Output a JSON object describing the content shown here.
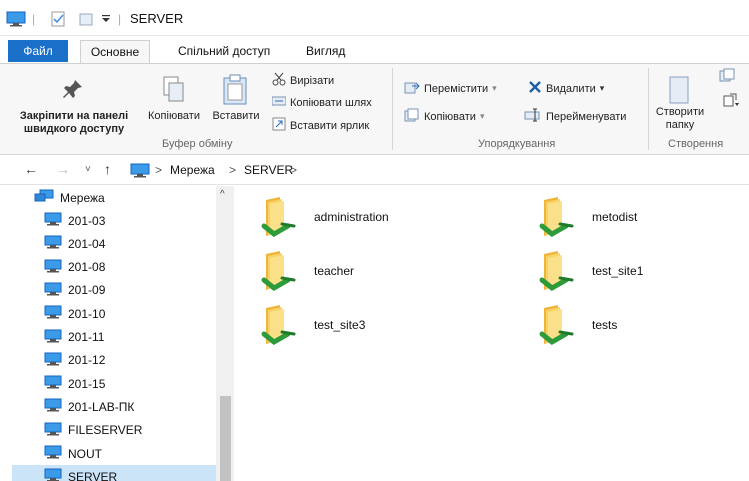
{
  "window": {
    "title": "SERVER"
  },
  "tabs": {
    "file": "Файл",
    "home": "Основне",
    "share": "Спільний доступ",
    "view": "Вигляд"
  },
  "ribbon": {
    "pin": "Закріпити на панелі швидкого доступу",
    "copy": "Копіювати",
    "paste": "Вставити",
    "cut": "Вирізати",
    "copy_path": "Копіювати шлях",
    "paste_shortcut": "Вставити ярлик",
    "clipboard_group": "Буфер обміну",
    "move_to": "Перемістити",
    "copy_to": "Копіювати",
    "delete": "Видалити",
    "rename": "Перейменувати",
    "organize_group": "Упорядкування",
    "new_folder": "Створити папку",
    "new_group": "Створення"
  },
  "nav": {
    "crumb1": "Мережа",
    "crumb2": "SERVER",
    "sep": ">"
  },
  "sidebar": {
    "root": "Мережа",
    "items": [
      {
        "label": "201-03"
      },
      {
        "label": "201-04"
      },
      {
        "label": "201-08"
      },
      {
        "label": "201-09"
      },
      {
        "label": "201-10"
      },
      {
        "label": "201-11"
      },
      {
        "label": "201-12"
      },
      {
        "label": "201-15"
      },
      {
        "label": "201-LAB-ПК"
      },
      {
        "label": "FILESERVER"
      },
      {
        "label": "NOUT"
      },
      {
        "label": "SERVER"
      }
    ]
  },
  "folders": [
    {
      "label": "administration"
    },
    {
      "label": "metodist"
    },
    {
      "label": "teacher"
    },
    {
      "label": "test_site1"
    },
    {
      "label": "test_site3"
    },
    {
      "label": "tests"
    }
  ],
  "colors": {
    "accent": "#1a6fc9",
    "folder": "#f6c443",
    "share": "#2e9b3a",
    "selected": "#cce4f7"
  }
}
